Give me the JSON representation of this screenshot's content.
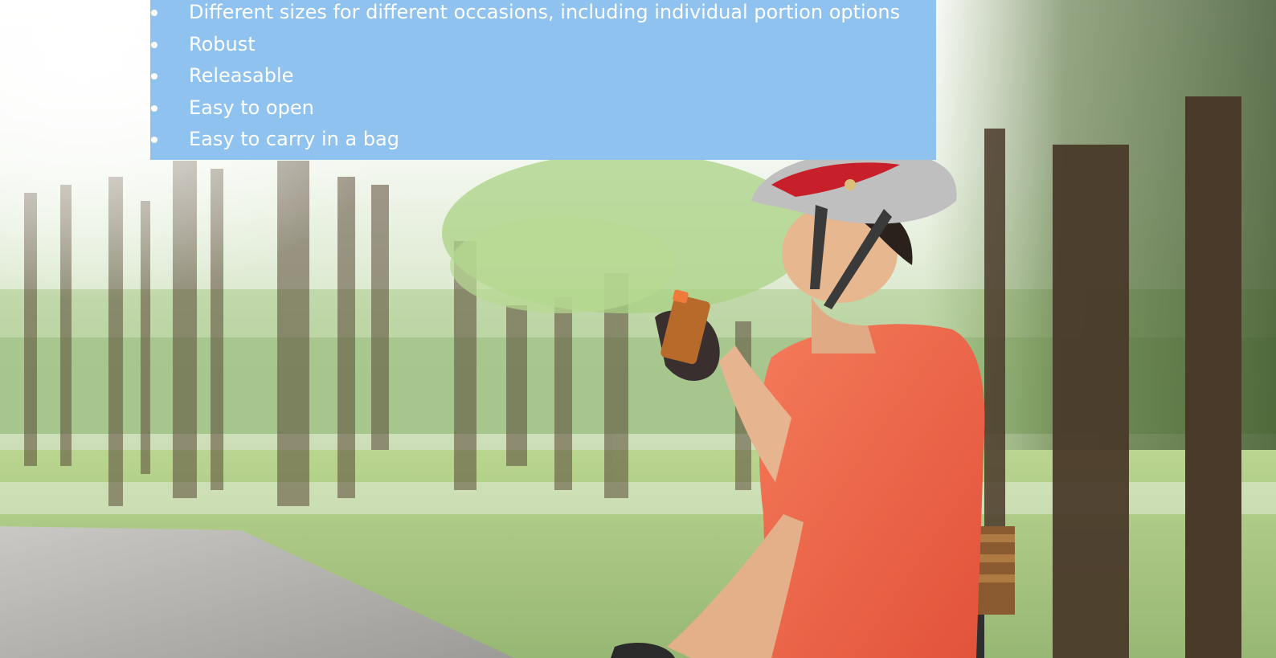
{
  "features": {
    "items": [
      "Different sizes for different occasions, including individual portion options",
      "Robust",
      "Releasable",
      "Easy to open",
      "Easy to carry in a bag"
    ]
  },
  "colors": {
    "panel_bg": "#8fc2ee",
    "panel_text": "#ffffff",
    "shirt": "#f0644a",
    "foliage": "#9bcc6e",
    "trunk": "#4a3a2a"
  },
  "image": {
    "scene_description_icon": "park-cyclist-photo"
  }
}
